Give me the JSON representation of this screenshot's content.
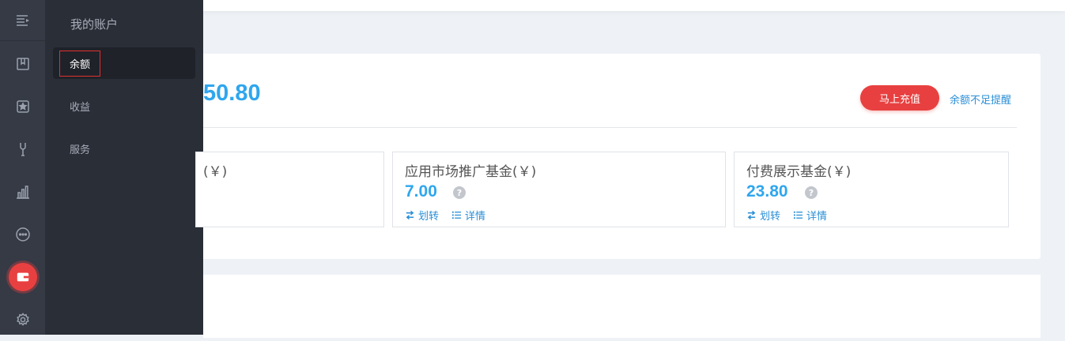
{
  "sidebar": {
    "icons": [
      "menu-icon",
      "bookmark-icon",
      "star-icon",
      "tools-icon",
      "chart-icon",
      "message-icon",
      "wallet-icon",
      "settings-icon"
    ],
    "active": "wallet-icon",
    "accent": "#e84040"
  },
  "submenu": {
    "title": "我的账户",
    "items": [
      {
        "label": "余额",
        "active": true
      },
      {
        "label": "收益",
        "active": false
      },
      {
        "label": "服务",
        "active": false
      }
    ]
  },
  "account": {
    "balance": "50.80",
    "recharge_label": "马上充值",
    "remind_label": "余额不足提醒"
  },
  "funds": [
    {
      "name": "(￥)",
      "value": "",
      "transfer": "",
      "detail": ""
    },
    {
      "name": "应用市场推广基金(￥)",
      "value": "7.00",
      "help": "?",
      "transfer": "划转",
      "detail": "详情"
    },
    {
      "name": "付费展示基金(￥)",
      "value": "23.80",
      "help": "?",
      "transfer": "划转",
      "detail": "详情"
    }
  ],
  "colors": {
    "accent_blue": "#2fa6ee",
    "link_blue": "#2b8fd6",
    "danger_red": "#e84040"
  }
}
